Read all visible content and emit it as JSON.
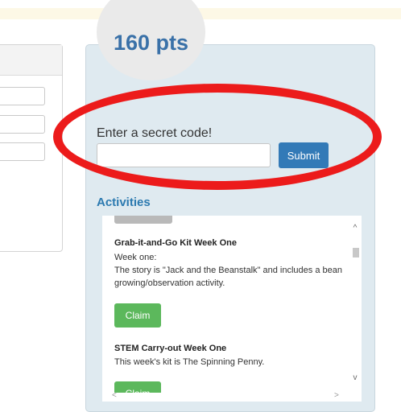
{
  "points": {
    "text": "160 pts"
  },
  "code": {
    "label": "Enter a secret code!",
    "placeholder": "",
    "submit_label": "Submit"
  },
  "activities": {
    "title": "Activities",
    "items": [
      {
        "title": "Grab-it-and-Go Kit Week One",
        "line1": "Week one:",
        "line2": "The story is \"Jack and the Beanstalk\" and includes a bean growing/observation activity.",
        "claim_label": "Claim"
      },
      {
        "title": "STEM Carry-out Week One",
        "line1": "This week's kit is The Spinning Penny.",
        "claim_label": "Claim"
      }
    ]
  },
  "scroll": {
    "up": "^",
    "down": "v",
    "left": "<",
    "right": ">"
  },
  "colors": {
    "primary": "#337ab7",
    "success": "#5cb85c",
    "highlight": "#ec1b1b",
    "panel": "#dfeaf0"
  }
}
